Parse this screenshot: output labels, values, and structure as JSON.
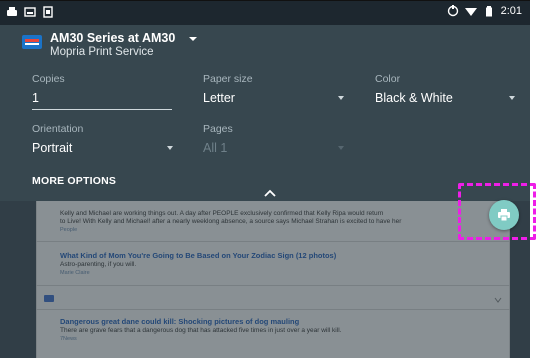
{
  "status_bar": {
    "time": "2:01"
  },
  "printer": {
    "name": "AM30 Series at AM30",
    "service": "Mopria Print Service"
  },
  "fields": {
    "copies": {
      "label": "Copies",
      "value": "1"
    },
    "paper_size": {
      "label": "Paper size",
      "value": "Letter"
    },
    "color": {
      "label": "Color",
      "value": "Black & White"
    },
    "orientation": {
      "label": "Orientation",
      "value": "Portrait"
    },
    "pages": {
      "label": "Pages",
      "value": "All 1"
    }
  },
  "more_options": "MORE OPTIONS",
  "document": {
    "stories": [
      {
        "text1": "Kelly and Michael are working things out. A day after PEOPLE exclusively confirmed that Kelly Ripa would return",
        "text2": "to Live! With Kelly and Michael! after a nearly weeklong absence, a source says Michael Strahan is excited to have her",
        "source": "People"
      },
      {
        "title": "What Kind of Mom You're Going to Be Based on Your Zodiac Sign (12 photos)",
        "text": "Astro-parenting, if you will.",
        "source": "Marie Claire"
      },
      {
        "title": "Dangerous great dane could kill: Shocking pictures of dog mauling",
        "text": "There are grave fears that a dangerous dog that has attacked five times in just over a year will kill.",
        "source": "7News"
      }
    ]
  },
  "colors": {
    "panel": "#37474f",
    "fab": "#80cbc4",
    "highlight": "#ee1ee8"
  }
}
